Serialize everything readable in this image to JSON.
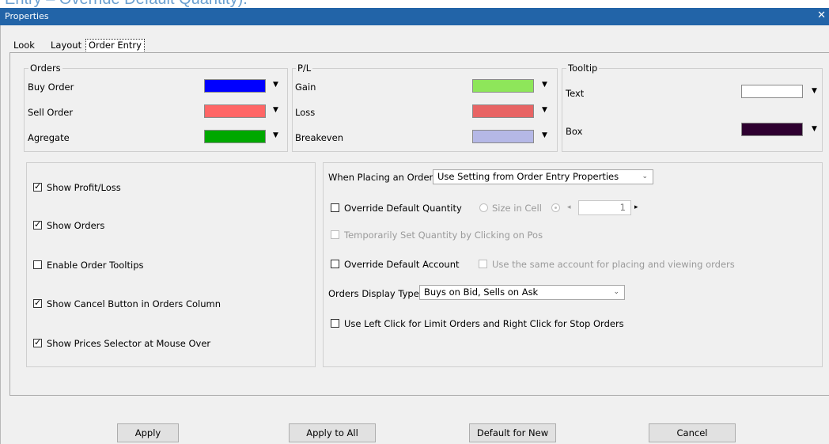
{
  "background_text": "Entry – Override Default Quantity).",
  "window": {
    "title": "Properties",
    "close": "✕"
  },
  "tabs": [
    {
      "label": "Look"
    },
    {
      "label": "Layout"
    },
    {
      "label": "Order Entry",
      "active": true
    }
  ],
  "orders": {
    "legend": "Orders",
    "rows": [
      {
        "label": "Buy Order",
        "color": "#0000ff"
      },
      {
        "label": "Sell Order",
        "color": "#ff6666"
      },
      {
        "label": "Agregate",
        "color": "#00a800"
      }
    ]
  },
  "pl": {
    "legend": "P/L",
    "rows": [
      {
        "label": "Gain",
        "color": "#8ee65a"
      },
      {
        "label": "Loss",
        "color": "#e86464"
      },
      {
        "label": "Breakeven",
        "color": "#b5b8e6"
      }
    ]
  },
  "tooltip": {
    "legend": "Tooltip",
    "rows": [
      {
        "label": "Text",
        "color": "#ffffff"
      },
      {
        "label": "Box",
        "color": "#2e0030"
      }
    ]
  },
  "left_options": [
    {
      "label": "Show Profit/Loss",
      "checked": true
    },
    {
      "label": "Show Orders",
      "checked": true
    },
    {
      "label": "Enable Order Tooltips",
      "checked": false
    },
    {
      "label": "Show Cancel Button in Orders Column",
      "checked": true
    },
    {
      "label": "Show Prices Selector at Mouse Over",
      "checked": true
    }
  ],
  "right": {
    "placing_label": "When Placing an Order",
    "placing_value": "Use Setting from Order Entry Properties",
    "override_qty_label": "Override Default Quantity",
    "size_in_cell_label": "Size in Cell",
    "quantity_value": "1",
    "temp_qty_label": "Temporarily Set Quantity by Clicking on Pos",
    "override_account_label": "Override Default Account",
    "same_account_label": "Use the same account for placing and viewing orders",
    "display_type_label": "Orders Display Type",
    "display_type_value": "Buys on Bid, Sells on Ask",
    "left_click_label": "Use Left Click for Limit Orders and Right Click for Stop Orders"
  },
  "buttons": {
    "apply": "Apply",
    "apply_all": "Apply to All",
    "default_new": "Default for New",
    "cancel": "Cancel"
  }
}
